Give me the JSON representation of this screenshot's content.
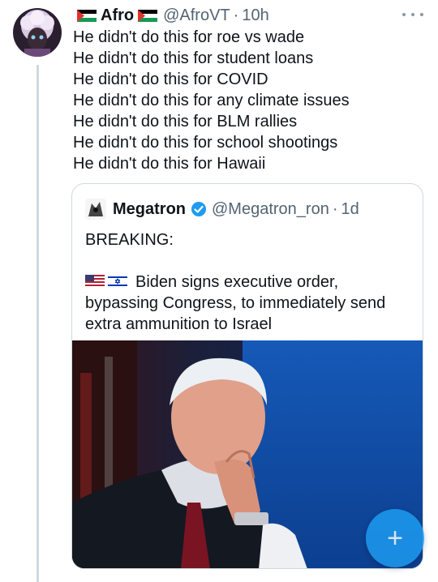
{
  "tweet": {
    "author_name": "Afro",
    "handle": "@AfroVT",
    "separator": "·",
    "time": "10h",
    "lines": [
      "He didn't do this for roe vs wade",
      "He didn't do this for student loans",
      "He didn't do this for COVID",
      "He didn't do this for any climate issues",
      "He didn't do this for BLM rallies",
      "He didn't do this for school shootings",
      "He didn't do this for Hawaii"
    ]
  },
  "quote": {
    "author_name": "Megatron",
    "handle": "@Megatron_ron",
    "separator": "·",
    "time": "1d",
    "heading": "BREAKING:",
    "body_lines": [
      "Biden signs executive order,",
      "bypassing Congress, to immediately send",
      "extra ammunition to Israel"
    ]
  },
  "fab": {
    "symbol": "+"
  },
  "icons": {
    "flag_left": "palestine-flag-icon",
    "flag_right": "palestine-flag-icon",
    "verified": "verified-badge-icon",
    "more": "more-options-icon",
    "us_flag": "usa-flag-icon",
    "israel_flag": "israel-flag-icon"
  },
  "colors": {
    "accent": "#1d9bf0",
    "secondary_text": "#536471",
    "border": "#cfd9de"
  }
}
